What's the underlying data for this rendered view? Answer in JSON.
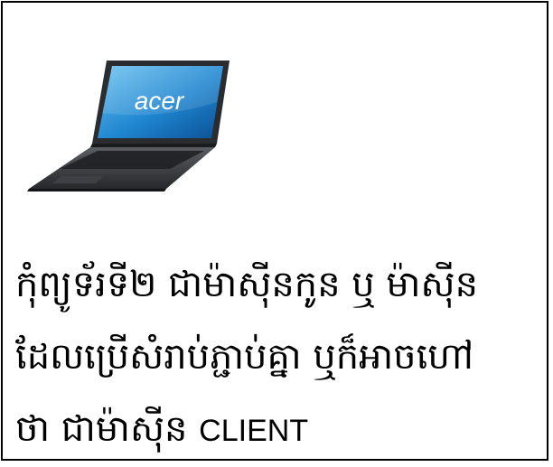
{
  "image": {
    "icon": "laptop-icon",
    "logo_text": "acer"
  },
  "caption": {
    "line1": "កុំព្យូទ័រទី២ ជាម៉ាស៊ីនកូន ឬ ម៉ាស៊ីន",
    "line2": "ដែលប្រើសំរាប់ភ្ជាប់គ្នា ឬក៏អាចហៅ",
    "line3_prefix": "ថា ជាម៉ាស៊ីន ",
    "line3_term": "CLIENT"
  }
}
